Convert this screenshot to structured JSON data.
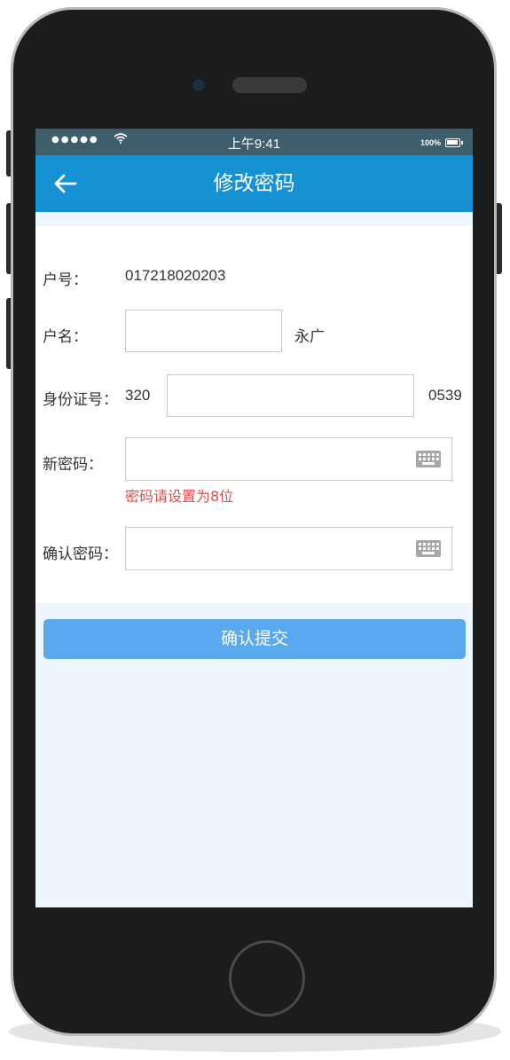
{
  "statusbar": {
    "signal": "●●●●●",
    "wifi_icon": "wifi-icon",
    "time": "上午9:41",
    "battery": "100%"
  },
  "header": {
    "back_icon": "arrow-left-icon",
    "title": "修改密码"
  },
  "form": {
    "account_no_label": "户号：",
    "account_no_value": "017218020203",
    "account_name_label": "户名：",
    "account_name_input": "",
    "account_name_suffix": "永广",
    "id_label": "身份证号：",
    "id_prefix": "320",
    "id_input": "",
    "id_suffix": "0539",
    "new_password_label": "新密码：",
    "new_password_input": "",
    "new_password_hint": "密码请设置为8位",
    "confirm_password_label": "确认密码：",
    "confirm_password_input": "",
    "keyboard_icon": "keyboard-icon"
  },
  "submit_label": "确认提交",
  "colors": {
    "navbar": "#1591d4",
    "statusbar": "#3f5e6b",
    "button": "#5aa9ee",
    "hint": "#e34c4c",
    "background": "#eef5fd"
  }
}
